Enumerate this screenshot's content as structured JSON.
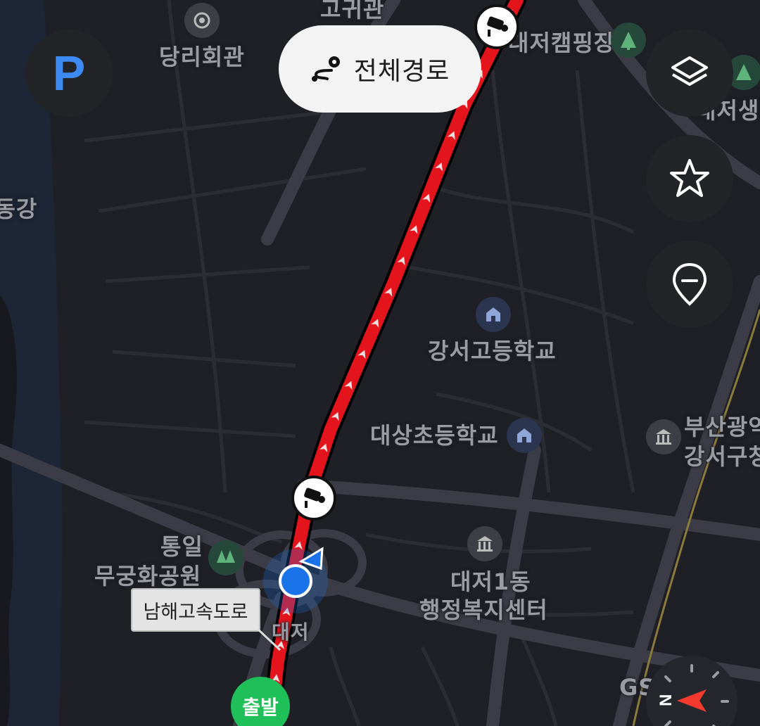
{
  "parking": {
    "label": "P"
  },
  "route_overview": {
    "label": "전체경로"
  },
  "places": {
    "danglihall": "당리회관",
    "top_partial": "고귀관",
    "camping": "대저캠핑장",
    "ecocenter": "대저생태",
    "nakdong": "낙동강",
    "gangseo_high": "강서고등학교",
    "daesang_elem": "대상초등학교",
    "busan_gangseo_line1": "부산광역",
    "busan_gangseo_line2": "강서구청",
    "daejeo1_line1": "대저1동",
    "daejeo1_line2": "행정복지센터",
    "tongil_line1": "통일",
    "tongil_line2": "무궁화공원",
    "jc_label": "대저",
    "gs": "GS"
  },
  "road_tooltip": "남해고속도로",
  "start_marker": "출발",
  "compass": {
    "north_letter": "N"
  },
  "colors": {
    "route": "#e4141c",
    "location": "#1a73e8",
    "start": "#1fbf5a",
    "parking": "#3d8bf2"
  }
}
